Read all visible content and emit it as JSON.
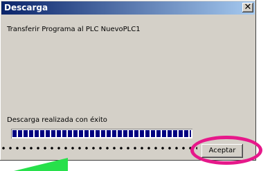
{
  "window": {
    "title": "Descarga",
    "close_glyph": "✕",
    "message": "Transferir Programa al PLC NuevoPLC1",
    "status": "Descarga realizada con éxito",
    "progress": 1.0,
    "ok_label": "Aceptar"
  },
  "annotations": {
    "highlight_color": "#e6188a",
    "dots_color": "#000000",
    "accent_color": "#27e04b"
  },
  "icons": {
    "close": "close-icon"
  }
}
